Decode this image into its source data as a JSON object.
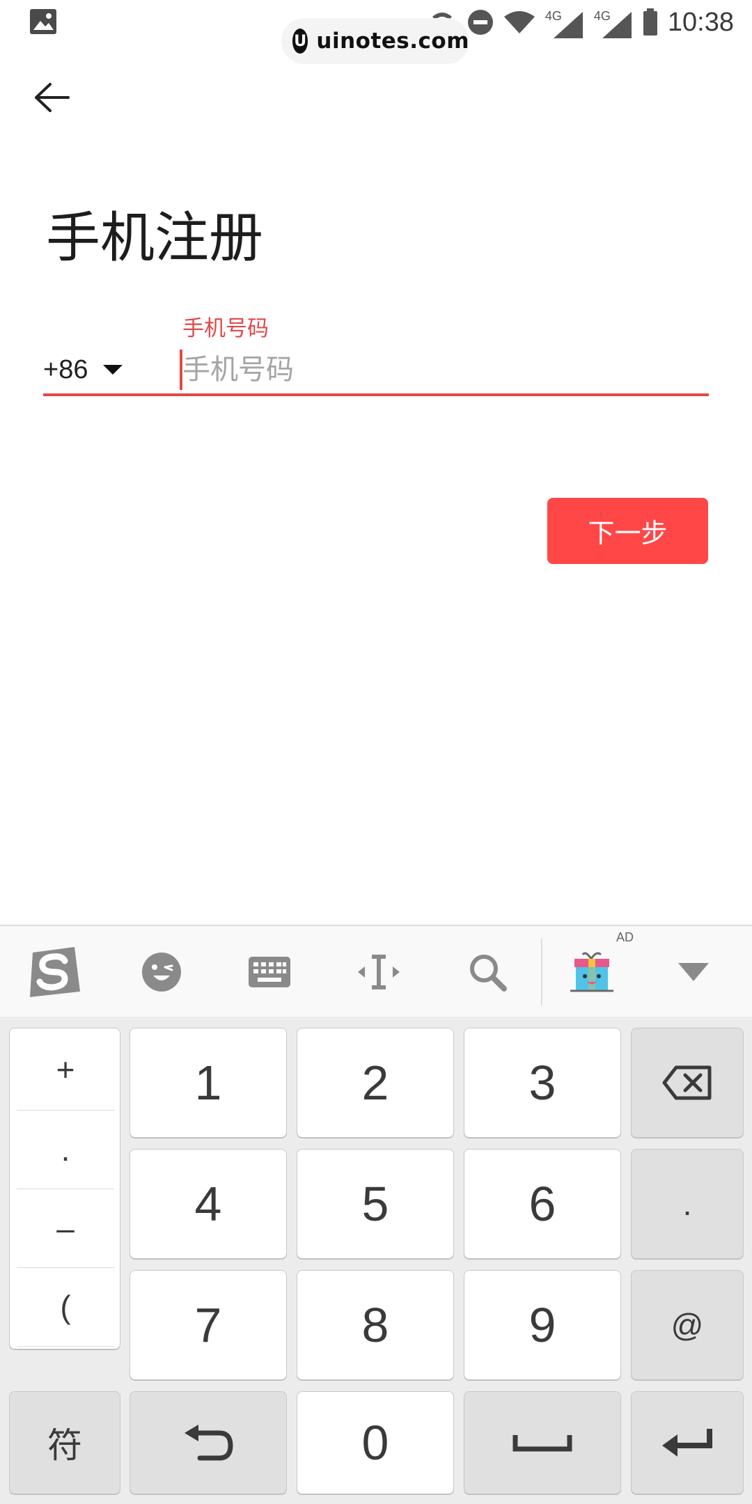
{
  "status_bar": {
    "time": "10:38",
    "network_1": "4G",
    "network_2": "4G"
  },
  "watermark": {
    "logo_letter": "U",
    "text": "uinotes.com"
  },
  "page": {
    "title": "手机注册"
  },
  "form": {
    "label": "手机号码",
    "country_code": "+86",
    "phone_placeholder": "手机号码",
    "phone_value": ""
  },
  "actions": {
    "next_label": "下一步"
  },
  "ime_toolbar": {
    "ad_tag": "AD",
    "icons": [
      "sogou-logo-icon",
      "emoji-icon",
      "keyboard-icon",
      "cursor-move-icon",
      "search-icon",
      "gift-icon",
      "collapse-keyboard-icon"
    ]
  },
  "keyboard": {
    "symbols": [
      "+",
      ".",
      "–",
      "("
    ],
    "digits": [
      "1",
      "2",
      "3",
      "4",
      "5",
      "6",
      "7",
      "8",
      "9",
      "0"
    ],
    "dot_key": ".",
    "at_key": "@",
    "symbol_key": "符"
  },
  "colors": {
    "accent": "#e14a4a",
    "button": "#ff4747",
    "keyboard_bg": "#ececec"
  }
}
